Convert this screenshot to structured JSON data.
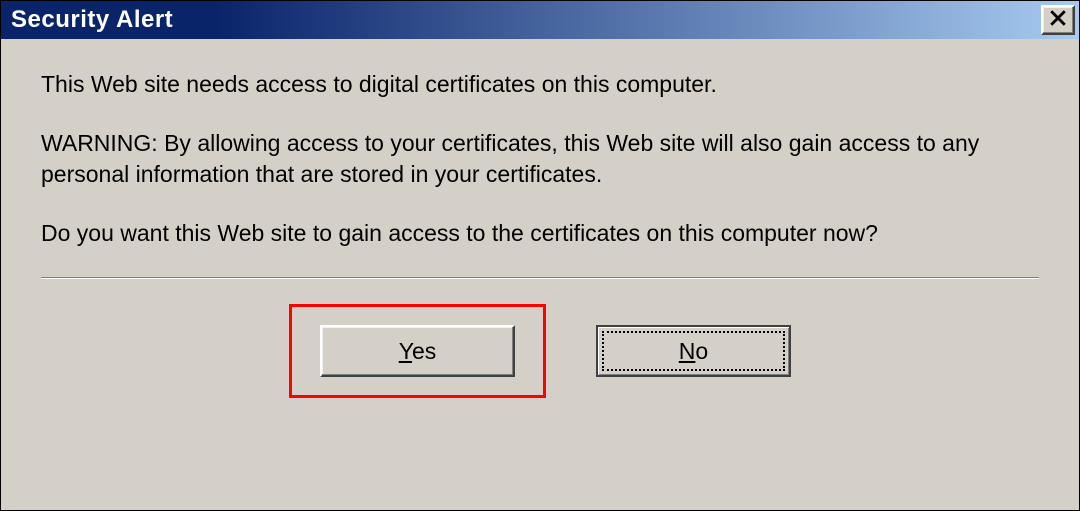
{
  "window": {
    "title": "Security Alert"
  },
  "message": {
    "line1": "This Web site needs access to digital certificates on this computer.",
    "line2": "WARNING: By allowing access to your certificates, this Web site will also gain access to any personal information that are stored in your certificates.",
    "line3": "Do you want this Web site to gain access to the certificates on this computer now?"
  },
  "buttons": {
    "yes": {
      "prefix": "",
      "accel": "Y",
      "suffix": "es"
    },
    "no": {
      "prefix": "",
      "accel": "N",
      "suffix": "o"
    }
  },
  "annotations": {
    "highlight_color": "#ff0000"
  }
}
